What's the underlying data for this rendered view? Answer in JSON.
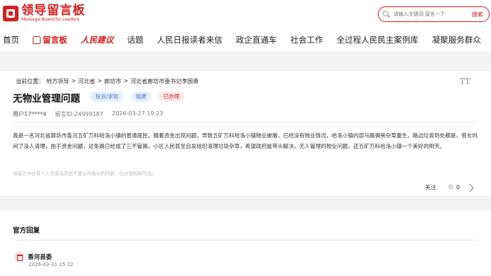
{
  "header": {
    "logo_cn": "领导留言板",
    "logo_en": "Message Board for Leaders",
    "search_placeholder": "请输入关键词 留言一下",
    "search_button": "搜索"
  },
  "nav": [
    {
      "label": "首页",
      "kind": "normal"
    },
    {
      "label": "留言板",
      "kind": "active"
    },
    {
      "label": "人民建议",
      "kind": "brand"
    },
    {
      "label": "话题",
      "kind": "normal"
    },
    {
      "label": "人民日报读者来信",
      "kind": "normal"
    },
    {
      "label": "政企直通车",
      "kind": "normal"
    },
    {
      "label": "社会工作",
      "kind": "normal"
    },
    {
      "label": "全过程人民民主案例库",
      "kind": "normal"
    },
    {
      "label": "凝聚服务群众",
      "kind": "normal"
    }
  ],
  "breadcrumb": [
    "当前位置：",
    "地方领导",
    ">",
    "河北省",
    ">",
    "廊坊市",
    ">",
    "河北省廊坊市委书记李国勇"
  ],
  "font_toggle": "TT",
  "message": {
    "title": "无物业管理问题",
    "tags": [
      "投诉/求助",
      "城建",
      "已办理"
    ],
    "user": "用户17****4",
    "id": "留言ID:24999187",
    "time": "2026-03-27 19:23",
    "body": "我是一名河北省廊坊市香河五矿万科哈洛小镇的普通居民。随着资金出现问题，导致五矿万科哈洛小镇物业被撤，已经没有物业情况，哈洛小镇内部马路俩旁杂草重生，路边垃圾到处都是，很长时间了没人清理，由于资金问题，这条路已经成了三不管路，小区人民甚至自发组织清理垃圾杂草，希望政府能带头解决，无人管理的物业问题，还五矿万科哈洛小镇一个美好的明天。",
    "disclaimer": "该留言中含有个人信息或其他不便公开展示的内容，仅办理机构可见。",
    "follow_label": "关注",
    "like_count": "0"
  },
  "reply": {
    "section_title": "官方回复",
    "org_name": "香河县委",
    "time": "2026-03-31 15:22"
  },
  "colors": {
    "accent": "#d42021",
    "tag_blue": "#4a7bc8"
  },
  "icons": [
    "logo-mark-icon",
    "search-icon",
    "message-board-icon",
    "font-size-icon",
    "star-icon",
    "share-icon",
    "government-building-icon"
  ]
}
